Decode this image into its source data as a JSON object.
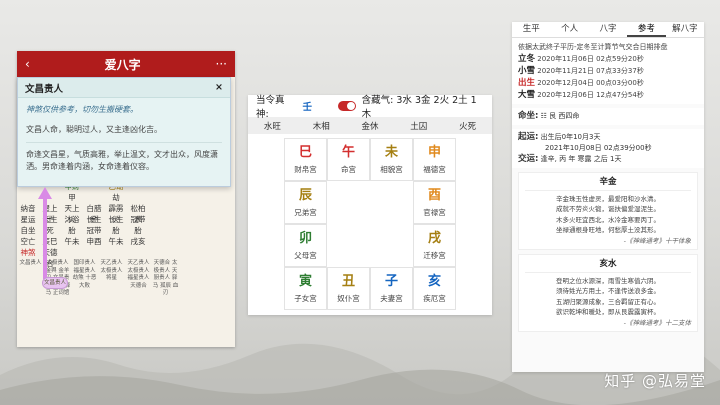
{
  "phone": {
    "back": "‹",
    "title": "爱八字",
    "more": "···",
    "popup": {
      "title": "文昌贵人",
      "close": "×",
      "hint": "神煞仅供参考，切勿生搬硬套。",
      "line1": "文昌人命，聪明过人，又主逢凶化吉。",
      "line2": "命逢文昌星，气质高雅，举止温文，文才出众，风度潇洒。男命逢着内涵，女命逢着仪容。"
    },
    "grid_rows": [
      [
        "",
        "",
        "甲财",
        "",
        "乙劫",
        ""
      ],
      [
        "",
        "",
        "甲",
        "",
        "劫",
        ""
      ],
      [
        "纳音",
        "屋上土",
        "天上火",
        "白腊金",
        "霹雳火",
        "松柏木"
      ],
      [
        "星运",
        "长生",
        "沐浴",
        "长生",
        "长生",
        "冠带"
      ],
      [
        "自坐",
        "死",
        "胎",
        "冠带",
        "胎",
        "胎"
      ],
      [
        "空亡",
        "辰巳",
        "午未",
        "申酉",
        "午未",
        "戌亥"
      ],
      [
        "神煞",
        "天德合",
        "",
        "",
        "",
        ""
      ]
    ],
    "notes": [
      "文昌贵人",
      "太极贵人 金舆 金羊刃 文昌贵人 亡神 驿马 正词馆",
      "国印贵人 福星贵人 劫煞 十恶大败",
      "天乙贵人 太极贵人 将星",
      "天乙贵人 太极贵人 福星贵人 天德合",
      "天德合 太极贵人 天厨贵人 驿马 孤辰 血刃"
    ],
    "badge": "文昌贵人"
  },
  "center": {
    "true_god_label": "当令真神:",
    "true_god_value": "壬",
    "hidden_label": "含藏气: 3水 3金 2火 2土 1木",
    "phases": [
      "水旺",
      "木相",
      "金休",
      "土囚",
      "火死"
    ],
    "palaces": [
      {
        "gz": "巳",
        "lbl": "财帛宫",
        "color": "red",
        "pos": "r0c0"
      },
      {
        "gz": "午",
        "lbl": "命宫",
        "color": "red",
        "pos": "r0c1"
      },
      {
        "gz": "未",
        "lbl": "相貌宫",
        "color": "olive",
        "pos": "r0c2"
      },
      {
        "gz": "申",
        "lbl": "福德宫",
        "color": "orange",
        "pos": "r0c3"
      },
      {
        "gz": "辰",
        "lbl": "兄弟宫",
        "color": "olive",
        "pos": "r1c0"
      },
      {
        "gz": "酉",
        "lbl": "官禄宫",
        "color": "orange",
        "pos": "r1c3"
      },
      {
        "gz": "卯",
        "lbl": "父母宫",
        "color": "green",
        "pos": "r2c0"
      },
      {
        "gz": "戌",
        "lbl": "迁移宫",
        "color": "olive",
        "pos": "r2c3"
      },
      {
        "gz": "寅",
        "lbl": "子女宫",
        "color": "green",
        "pos": "r3c0"
      },
      {
        "gz": "丑",
        "lbl": "奴仆宫",
        "color": "olive",
        "pos": "r3c1"
      },
      {
        "gz": "子",
        "lbl": "夫妻宫",
        "color": "blue",
        "pos": "r3c2"
      },
      {
        "gz": "亥",
        "lbl": "疾厄宫",
        "color": "blue",
        "pos": "r3c3"
      }
    ]
  },
  "right": {
    "tabs": [
      "生平",
      "个人",
      "八字",
      "参考",
      "解八字"
    ],
    "active_tab": "参考",
    "intro": "依据太武终子平历-定冬至计算节气交合日期排盘",
    "rows": [
      {
        "key": "立冬",
        "val": "2020年11月06日 02点59分20秒",
        "red": false
      },
      {
        "key": "小雪",
        "val": "2020年11月21日 07点33分37秒",
        "red": false
      },
      {
        "key": "出生",
        "val": "2020年12月04日 00点03分00秒",
        "red": true
      },
      {
        "key": "大雪",
        "val": "2020年12月06日 12点47分54秒",
        "red": false
      }
    ],
    "mingzuo_key": "命坐:",
    "mingzuo_val": "☷ 艮 西四命",
    "qiyun_key": "起运:",
    "qiyun_val": "出生后0年10月3天",
    "qiyun_val2": "2021年10月08日 02点39分00秒",
    "jiaoyun_key": "交运:",
    "jiaoyun_val": "逢辛, 丙 年 寒露 之后 1天",
    "poems": [
      {
        "title": "辛金",
        "lines": [
          "辛金珠玉性虚灵，最爱阳和沙水清。",
          "成就不劳炎火锻，诞扶偏爱湿泥生。",
          "木多火旺宜西北，水冷金寒要丙丁。",
          "坐禄通根身旺地，何愁厚土没其形。"
        ],
        "src": "-《神峰通考》十干体象"
      },
      {
        "title": "亥水",
        "lines": [
          "登明之位水源深，雨雪生寒值六阴。",
          "须待甡光方用土，不逢传送浪多金。",
          "五湖归聚源成象，三合羁留正有心。",
          "欲识乾坤和暖处，即从艮震露寅杯。"
        ],
        "src": "-《神峰通考》十二支体"
      }
    ]
  },
  "watermark": "知乎 @弘易堂",
  "colors": {
    "brand_red": "#b01c1c",
    "phase_bg": "#eeeeee",
    "popup_bg": "#e6f3f3"
  }
}
